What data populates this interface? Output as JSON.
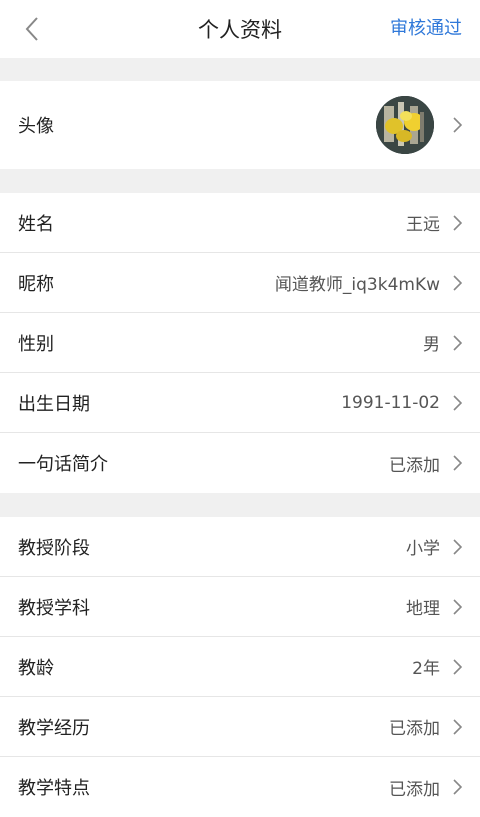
{
  "header": {
    "title": "个人资料",
    "status": "审核通过"
  },
  "rows": {
    "avatar": {
      "label": "头像"
    },
    "name": {
      "label": "姓名",
      "value": "王远"
    },
    "nickname": {
      "label": "昵称",
      "value": "闻道教师_iq3k4mKw"
    },
    "gender": {
      "label": "性别",
      "value": "男"
    },
    "birthday": {
      "label": "出生日期",
      "value": "1991-11-02"
    },
    "intro": {
      "label": "一句话简介",
      "value": "已添加"
    },
    "stage": {
      "label": "教授阶段",
      "value": "小学"
    },
    "subject": {
      "label": "教授学科",
      "value": "地理"
    },
    "years": {
      "label": "教龄",
      "value": "2年"
    },
    "experience": {
      "label": "教学经历",
      "value": "已添加"
    },
    "features": {
      "label": "教学特点",
      "value": "已添加"
    }
  },
  "colors": {
    "accent": "#2f78d9",
    "background": "#f0f0f0",
    "divider": "#e6e6e6"
  },
  "icons": {
    "back": "chevron-left-icon",
    "row_arrow": "chevron-right-icon"
  }
}
